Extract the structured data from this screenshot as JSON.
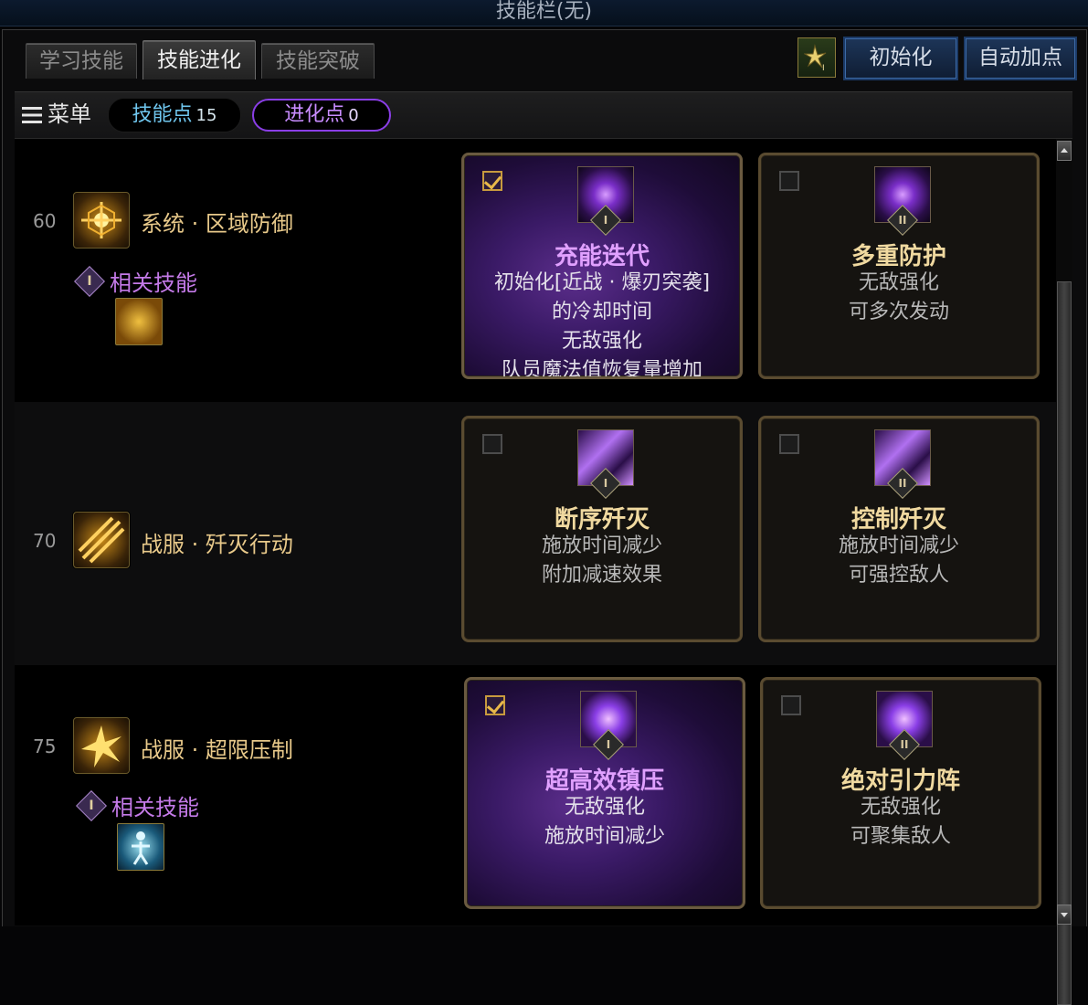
{
  "window_title": "技能栏(无)",
  "tabs": [
    {
      "label": "学习技能",
      "active": false
    },
    {
      "label": "技能进化",
      "active": true
    },
    {
      "label": "技能突破",
      "active": false
    }
  ],
  "buttons": {
    "reset": "初始化",
    "auto_add": "自动加点",
    "small_icon": "buff-skill-icon"
  },
  "menu": {
    "label": "菜单"
  },
  "points": {
    "skill_label": "技能点",
    "skill_value": "15",
    "evolve_label": "进化点",
    "evolve_value": "0"
  },
  "rows": [
    {
      "level": "60",
      "skill_name": "系统 · 区域防御",
      "related": "相关技能",
      "related_roman": "I",
      "options": [
        {
          "selected": true,
          "roman": "I",
          "title": "充能迭代",
          "desc": [
            "初始化[近战 · 爆刃突袭]",
            "的冷却时间",
            "无敌强化",
            "队员魔法值恢复量增加"
          ]
        },
        {
          "selected": false,
          "roman": "II",
          "title": "多重防护",
          "desc": [
            "无敌强化",
            "可多次发动"
          ]
        }
      ]
    },
    {
      "level": "70",
      "skill_name": "战服 · 歼灭行动",
      "related": "",
      "options": [
        {
          "selected": false,
          "roman": "I",
          "title": "断序歼灭",
          "desc": [
            "施放时间减少",
            "附加减速效果"
          ]
        },
        {
          "selected": false,
          "roman": "II",
          "title": "控制歼灭",
          "desc": [
            "施放时间减少",
            "可强控敌人"
          ]
        }
      ]
    },
    {
      "level": "75",
      "skill_name": "战服 · 超限压制",
      "related": "相关技能",
      "related_roman": "I",
      "options": [
        {
          "selected": true,
          "roman": "I",
          "title": "超高效镇压",
          "desc": [
            "无敌强化",
            "施放时间减少"
          ]
        },
        {
          "selected": false,
          "roman": "II",
          "title": "绝对引力阵",
          "desc": [
            "无敌强化",
            "可聚集敌人"
          ]
        }
      ]
    }
  ],
  "colors": {
    "accent_purple": "#8a3ee6",
    "gold_text": "#e8c98a",
    "skill_point_blue": "#6fc6ee"
  }
}
